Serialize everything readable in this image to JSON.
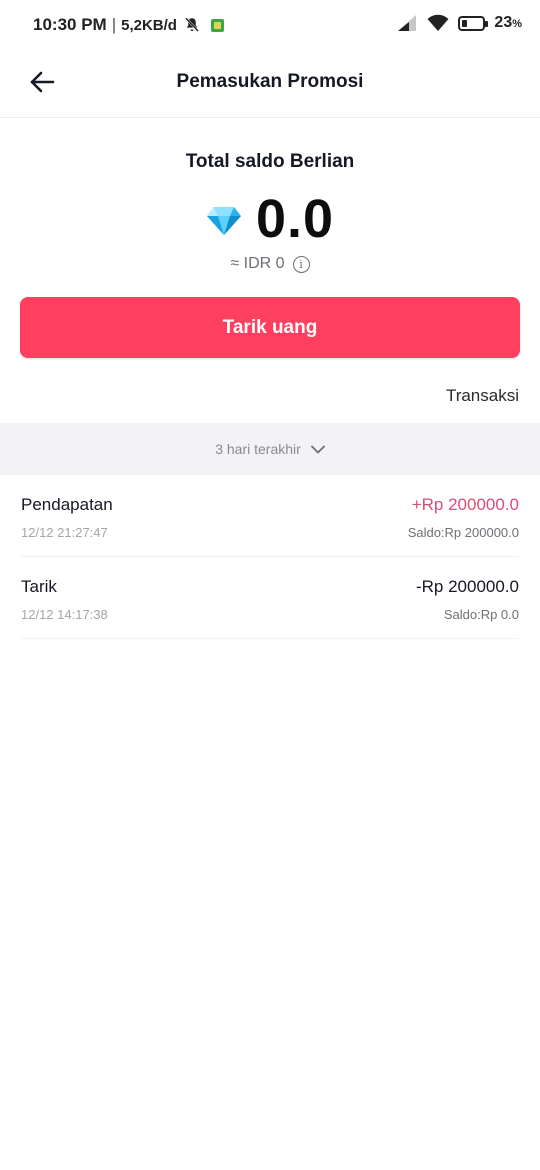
{
  "status_bar": {
    "time": "10:30 PM",
    "separator": "|",
    "net_speed": "5,2KB/d",
    "battery_percent": "23",
    "battery_unit": "%",
    "battery_level": 0.23,
    "icons": [
      "bell-off-icon",
      "app-notification-icon",
      "signal-icon",
      "wifi-icon",
      "battery-icon"
    ]
  },
  "header": {
    "back_icon": "arrow-left-icon",
    "title": "Pemasukan Promosi"
  },
  "balance": {
    "label": "Total saldo Berlian",
    "diamond_icon": "diamond-icon",
    "value": "0.0",
    "idr_text": "≈ IDR 0",
    "info_icon": "info-icon",
    "info_glyph": "i"
  },
  "withdraw_button": {
    "label": "Tarik uang",
    "color": "#fe3f60"
  },
  "transaksi_link": "Transaksi",
  "filter": {
    "label": "3 hari terakhir",
    "icon": "chevron-down-icon"
  },
  "transactions": [
    {
      "title": "Pendapatan",
      "amount": "+Rp 200000.0",
      "type": "income",
      "date": "12/12 21:27:47",
      "saldo": "Saldo:Rp 200000.0"
    },
    {
      "title": "Tarik",
      "amount": "-Rp 200000.0",
      "type": "withdraw",
      "date": "12/12 14:17:38",
      "saldo": "Saldo:Rp 0.0"
    }
  ],
  "colors": {
    "accent": "#fe3f60",
    "income": "#d94e76",
    "filter_bg": "#f3f2f5"
  }
}
